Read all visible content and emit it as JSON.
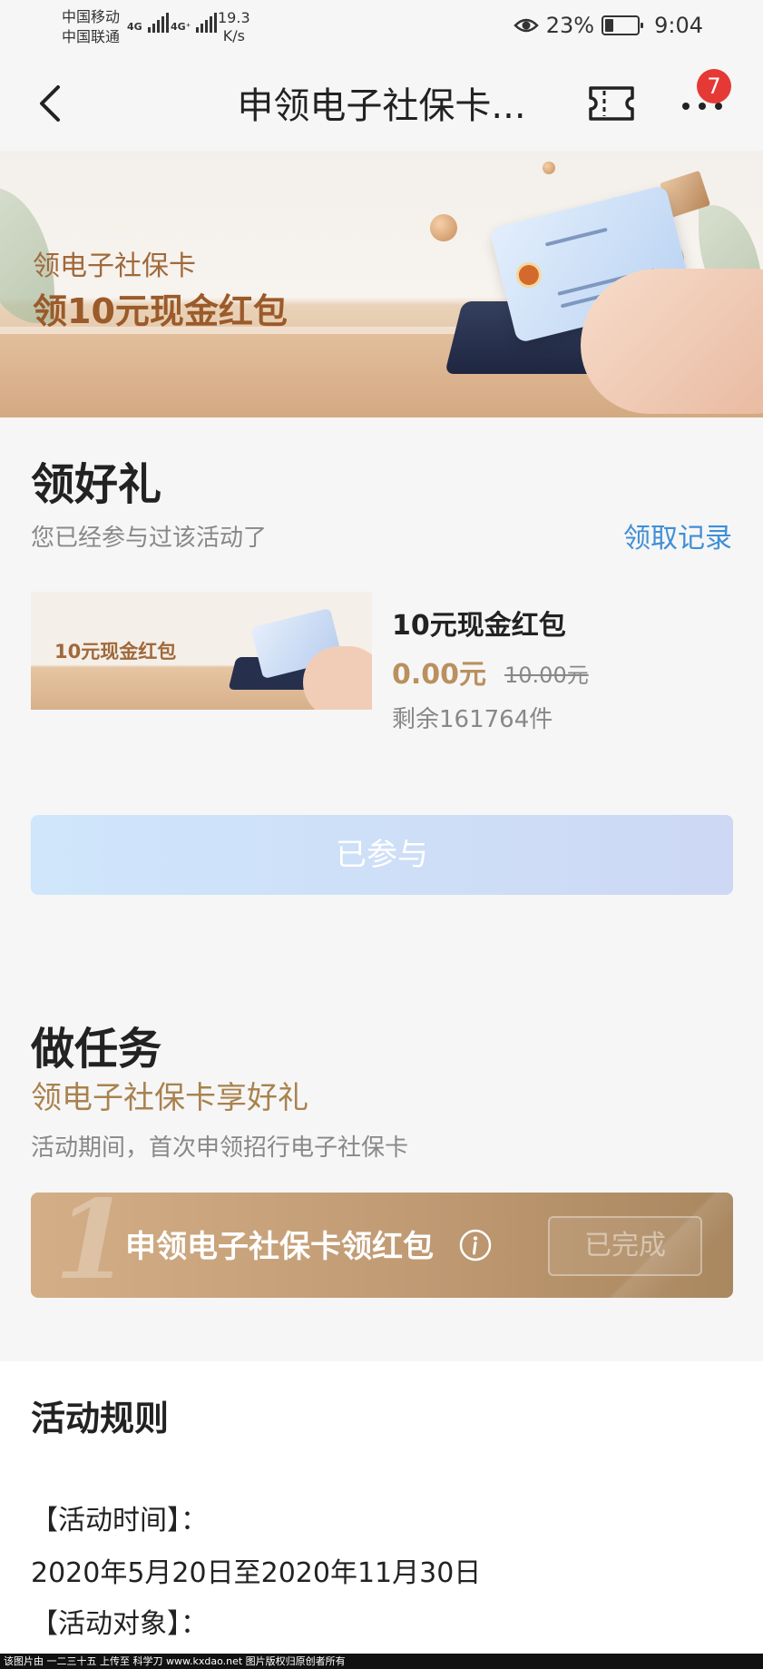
{
  "status_bar": {
    "carrier1": "中国移动",
    "carrier2": "中国联通",
    "sig1": "4G",
    "sig2": "4G⁺",
    "speed_value": "19.3",
    "speed_unit": "K/s",
    "battery": "23%",
    "time": "9:04"
  },
  "nav": {
    "title": "申领电子社保卡...",
    "badge_count": "7"
  },
  "banner": {
    "line1": "领电子社保卡",
    "line2": "领10元现金红包"
  },
  "gift_section": {
    "title": "领好礼",
    "status_text": "您已经参与过该活动了",
    "record_link": "领取记录",
    "product": {
      "image_label": "10元现金红包",
      "name": "10元现金红包",
      "price": "0.00元",
      "original_price": "10.00元",
      "remaining": "剩余161764件"
    },
    "button_label": "已参与"
  },
  "task_section": {
    "title": "做任务",
    "subtitle": "领电子社保卡享好礼",
    "description": "活动期间，首次申领招行电子社保卡",
    "task": {
      "number": "1",
      "title": "申领电子社保卡领红包",
      "button_label": "已完成"
    }
  },
  "rules": {
    "title": "活动规则",
    "time_label": "【活动时间】：",
    "time_value": "2020年5月20日至2020年11月30日",
    "target_label": "【活动对象】："
  },
  "footer": {
    "text": "该图片由 一二三十五 上传至 科学刀 www.kxdao.net 图片版权归原创者所有"
  },
  "colors": {
    "link_blue": "#3f8fd6",
    "gold": "#a9824f",
    "badge_red": "#e53935"
  }
}
